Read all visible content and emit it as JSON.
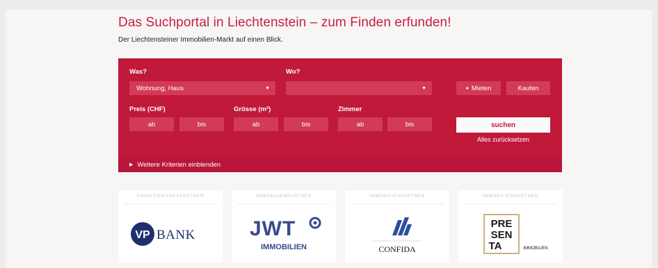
{
  "header": {
    "title": "Das Suchportal in Liechtenstein – zum Finden erfunden!",
    "subtitle": "Der Liechtensteiner Immobilien-Markt auf einen Blick."
  },
  "search": {
    "was_label": "Was?",
    "was_value": "Wohnung, Haus",
    "wo_label": "Wo?",
    "wo_value": "",
    "mode_options": [
      "Mieten",
      "Kaufen"
    ],
    "mode_selected": "Mieten",
    "price_label": "Preis (CHF)",
    "size_label": "Grösse (m²)",
    "rooms_label": "Zimmer",
    "from_placeholder": "ab",
    "to_placeholder": "bis",
    "search_button": "suchen",
    "reset_link": "Alles zurücksetzen",
    "more_criteria": "Weitere Kriterien einblenden"
  },
  "partners": [
    {
      "tag": "FINANZIERUNGSPARTNER",
      "logo_text": "BANK",
      "logo_prefix": "VP"
    },
    {
      "tag": "IMMOBILIENPARTNER",
      "logo_text": "JWT",
      "logo_sub": "IMMOBILIEN"
    },
    {
      "tag": "IMMOBILIENPARTNER",
      "logo_text": "CONFIDA"
    },
    {
      "tag": "IMMOBILIENPARTNER",
      "logo_lines": [
        "PRE",
        "SEN",
        "TA"
      ],
      "logo_sub": "IMMOBILIEN"
    }
  ],
  "colors": {
    "brand_red": "#c0193a",
    "field_red": "#d23a55",
    "vp_navy": "#1f2f6e",
    "jwt_blue": "#3a4a8c",
    "confida_blue": "#2b4f9c"
  }
}
